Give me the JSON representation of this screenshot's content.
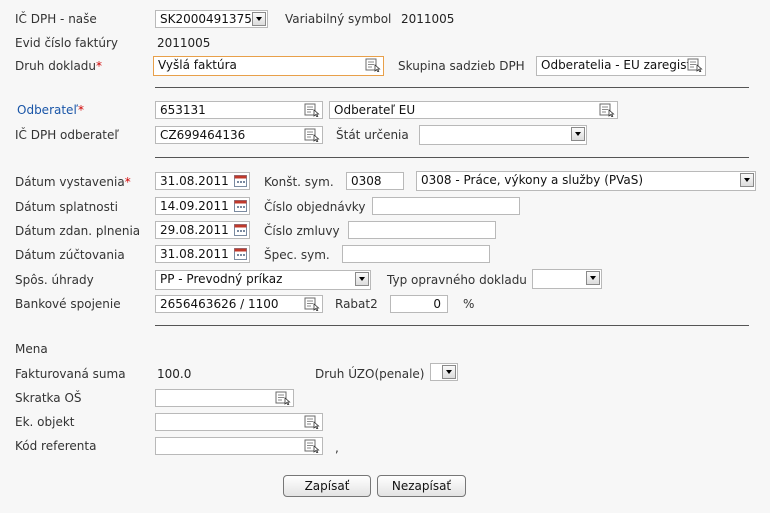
{
  "form": {
    "ic_dph_nase": {
      "label": "IČ DPH - naše",
      "value": "SK2000491375"
    },
    "variabilny_symbol": {
      "label": "Variabilný symbol",
      "value": "2011005"
    },
    "evid_cislo": {
      "label": "Evid číslo faktúry",
      "value": "2011005"
    },
    "druh_dokladu": {
      "label": "Druh dokladu",
      "required": "*",
      "value": "Vyšlá faktúra"
    },
    "skupina_sadzieb": {
      "label": "Skupina sadzieb DPH",
      "value": "Odberatelia - EU zaregist"
    },
    "odberatel": {
      "label": "Odberateľ",
      "required": "*",
      "code": "653131",
      "name": "Odberateľ EU"
    },
    "ic_dph_odberatel": {
      "label": "IČ DPH odberateľ",
      "value": "CZ699464136"
    },
    "stat_urcenia": {
      "label": "Štát určenia",
      "value": ""
    },
    "datum_vystavenia": {
      "label": "Dátum vystavenia",
      "required": "*",
      "value": "31.08.2011"
    },
    "konst_sym": {
      "label": "Konšt. sym.",
      "code": "0308",
      "description": "0308 - Práce, výkony a služby (PVaS)"
    },
    "datum_splatnosti": {
      "label": "Dátum splatnosti",
      "value": "14.09.2011"
    },
    "cislo_objednavky": {
      "label": "Číslo objednávky",
      "value": ""
    },
    "datum_zdan": {
      "label": "Dátum zdan. plnenia",
      "value": "29.08.2011"
    },
    "cislo_zmluvy": {
      "label": "Číslo zmluvy",
      "value": ""
    },
    "datum_zuctovania": {
      "label": "Dátum zúčtovania",
      "value": "31.08.2011"
    },
    "spec_sym": {
      "label": "Špec. sym.",
      "value": ""
    },
    "spos_uhrady": {
      "label": "Spôs. úhrady",
      "value": "PP - Prevodný príkaz"
    },
    "typ_opravneho": {
      "label": "Typ opravného dokladu",
      "value": ""
    },
    "bankove_spojenie": {
      "label": "Bankové spojenie",
      "value": "2656463626 / 1100"
    },
    "rabat2": {
      "label": "Rabat2",
      "value": "0",
      "unit": "%"
    },
    "mena": {
      "label": "Mena"
    },
    "fakturovana_suma": {
      "label": "Fakturovaná suma",
      "value": "100.0"
    },
    "druh_uzo": {
      "label": "Druh ÚZO(penale)",
      "value": ""
    },
    "skratka_os": {
      "label": "Skratka OŠ",
      "value": ""
    },
    "ek_objekt": {
      "label": "Ek. objekt",
      "value": ""
    },
    "kod_referenta": {
      "label": "Kód referenta",
      "value": "",
      "suffix": ","
    }
  },
  "buttons": {
    "save": "Zapísať",
    "cancel": "Nezapísať"
  },
  "icons": {
    "lookup": "lookup-icon",
    "calendar": "calendar-icon",
    "dropdown": "dropdown-arrow-icon"
  },
  "colors": {
    "required": "#d00000",
    "link_label": "#1a56a8",
    "active_border": "#e8a04a"
  }
}
